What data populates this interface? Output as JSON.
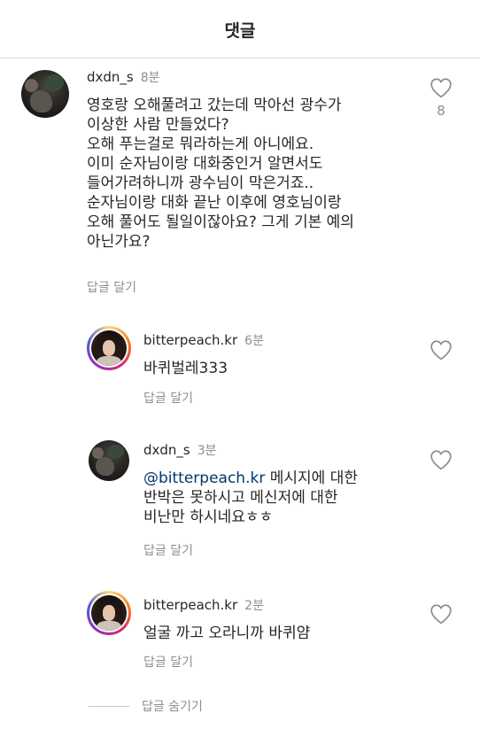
{
  "header": {
    "title": "댓글"
  },
  "comments": [
    {
      "username": "dxdn_s",
      "time": "8분",
      "text": "영호랑 오해풀려고 갔는데 막아선 광수가\n이상한 사람 만들었다?\n오해 푸는걸로 뭐라하는게 아니에요.\n이미 순자님이랑 대화중인거 알면서도\n들어가려하니까 광수님이 막은거죠..\n순자님이랑 대화 끝난 이후에 영호님이랑\n오해 풀어도 될일이잖아요? 그게 기본 예의\n아닌가요?",
      "reply_label": "답글 달기",
      "likes": "8",
      "avatar": "dark-photo-avatar"
    },
    {
      "username": "bitterpeach.kr",
      "time": "6분",
      "text": "바퀴벌레333",
      "reply_label": "답글 달기",
      "avatar": "story-ring-avatar"
    },
    {
      "username": "dxdn_s",
      "time": "3분",
      "mention": "@bitterpeach.kr",
      "text": " 메시지에 대한\n반박은 못하시고 메신저에 대한\n비난만 하시네요ㅎㅎ",
      "reply_label": "답글 달기",
      "avatar": "dark-photo-avatar"
    },
    {
      "username": "bitterpeach.kr",
      "time": "2분",
      "text": "얼굴 까고 오라니까 바퀴얌",
      "reply_label": "답글 달기",
      "avatar": "story-ring-avatar"
    }
  ],
  "hide_replies_label": "답글 숨기기",
  "icons": {
    "like": "heart-outline-icon"
  },
  "colors": {
    "text": "#262626",
    "secondary": "#8e8e8e",
    "mention": "#00376b",
    "divider": "#dbdbdb"
  }
}
